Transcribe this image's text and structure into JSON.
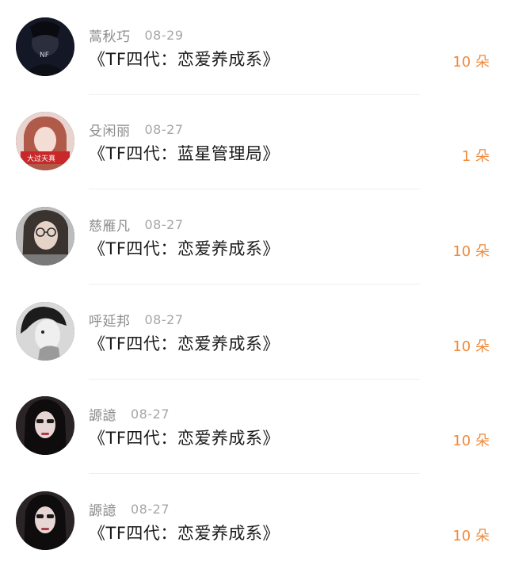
{
  "items": [
    {
      "user": "蒿秋巧",
      "date": "08-29",
      "title": "《TF四代：恋爱养成系》",
      "count": "10 朵",
      "avatar": "avatar-dark-logo",
      "avatar_text": "NF"
    },
    {
      "user": "殳闲丽",
      "date": "08-27",
      "title": "《TF四代：蓝星管理局》",
      "count": "1 朵",
      "avatar": "avatar-red-hair-girl",
      "avatar_text": "大过天真"
    },
    {
      "user": "慈雁凡",
      "date": "08-27",
      "title": "《TF四代：恋爱养成系》",
      "count": "10 朵",
      "avatar": "avatar-glasses-girl"
    },
    {
      "user": "呼延邦",
      "date": "08-27",
      "title": "《TF四代：恋爱养成系》",
      "count": "10 朵",
      "avatar": "avatar-bw-boy"
    },
    {
      "user": "謜譩",
      "date": "08-27",
      "title": "《TF四代：恋爱养成系》",
      "count": "10 朵",
      "avatar": "avatar-dark-sunglasses-girl"
    },
    {
      "user": "謜譩",
      "date": "08-27",
      "title": "《TF四代：恋爱养成系》",
      "count": "10 朵",
      "avatar": "avatar-dark-sunglasses-girl"
    }
  ],
  "colors": {
    "accent": "#f08a3c",
    "username": "#8b8b8b",
    "date": "#a6a6a6",
    "title": "#1a1a1a",
    "divider": "#efefef"
  }
}
